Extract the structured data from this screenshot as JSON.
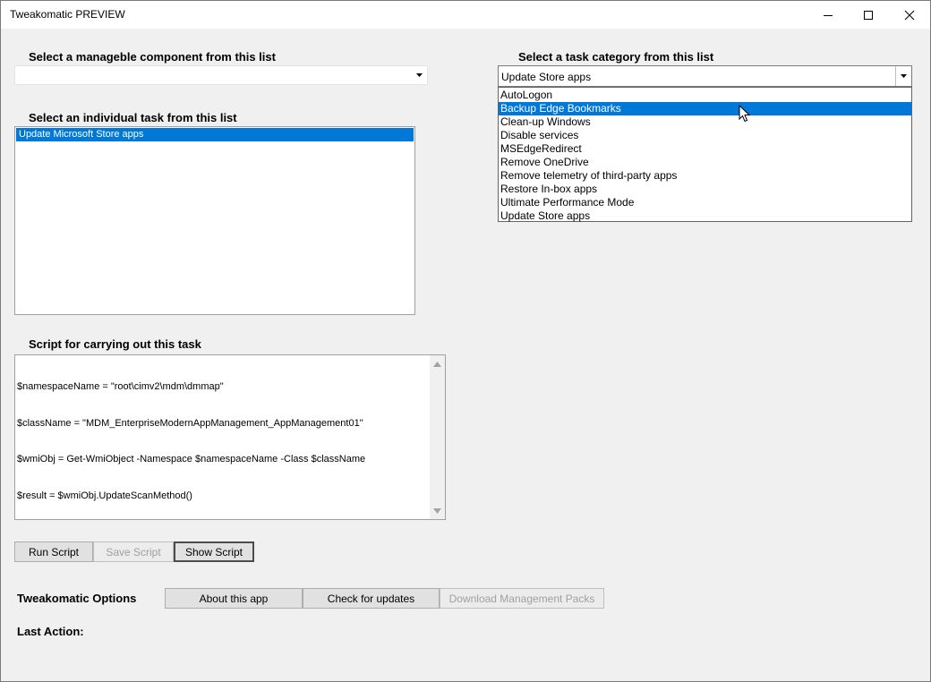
{
  "window": {
    "title": "Tweakomatic PREVIEW"
  },
  "component": {
    "label": "Select a manageble component from this list",
    "value": ""
  },
  "task_list": {
    "label": "Select an individual task from this list",
    "items": [
      "Update Microsoft Store apps"
    ],
    "selected_index": 0
  },
  "category": {
    "label": "Select a task category from this list",
    "value": "Update Store apps",
    "options": [
      "AutoLogon",
      "Backup Edge Bookmarks",
      "Clean-up Windows",
      "Disable services",
      "MSEdgeRedirect",
      "Remove OneDrive",
      "Remove telemetry of third-party apps",
      "Restore In-box apps",
      "Ultimate Performance Mode",
      "Update Store apps"
    ],
    "highlighted_index": 1
  },
  "script": {
    "label": "Script for carrying out this task",
    "lines": [
      "$namespaceName = \"root\\cimv2\\mdm\\dmmap\"",
      "$className = \"MDM_EnterpriseModernAppManagement_AppManagement01\"",
      "$wmiObj = Get-WmiObject -Namespace $namespaceName -Class $className",
      "$result = $wmiObj.UpdateScanMethod()"
    ]
  },
  "script_buttons": {
    "run": "Run Script",
    "save": "Save Script",
    "show": "Show Script"
  },
  "options": {
    "label": "Tweakomatic Options",
    "about": "About this app",
    "check_updates": "Check for updates",
    "download_packs": "Download Management Packs"
  },
  "status": {
    "label": "Last Action:",
    "value": ""
  },
  "icons": {
    "minimize": "minimize-icon",
    "maximize": "maximize-icon",
    "close": "close-icon",
    "dropdown_arrow": "dropdown-arrow-icon",
    "scroll_up": "scroll-up-arrow-icon",
    "scroll_down": "scroll-down-arrow-icon",
    "cursor": "mouse-pointer-icon"
  },
  "colors": {
    "selection": "#0078d7",
    "window_bg": "#f0f0f0",
    "disabled_text": "#a0a0a0"
  }
}
